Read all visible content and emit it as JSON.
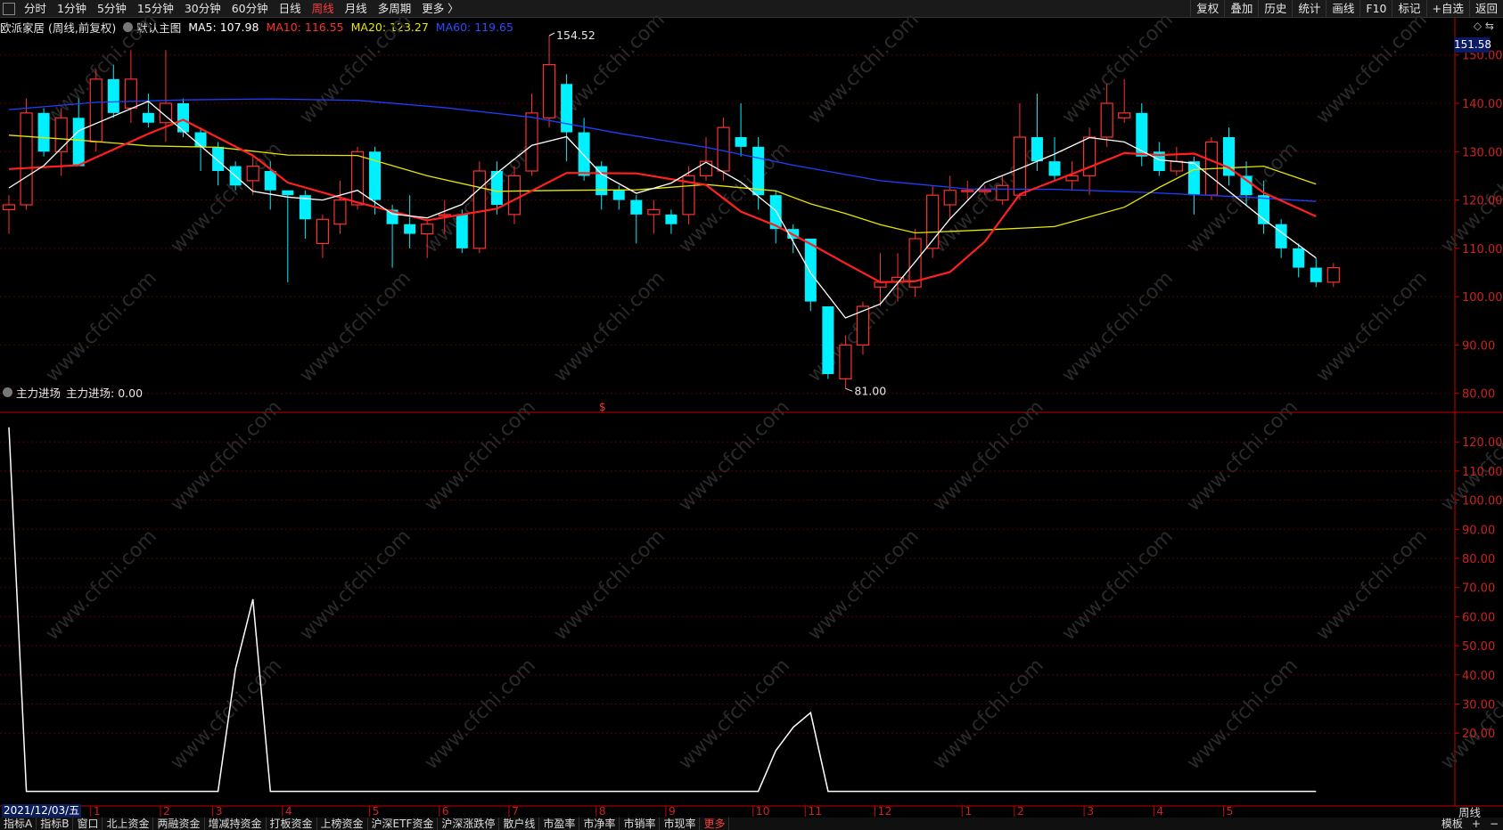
{
  "topbar": {
    "tabs": [
      "分时",
      "1分钟",
      "5分钟",
      "15分钟",
      "30分钟",
      "60分钟",
      "日线",
      "周线",
      "月线",
      "多周期",
      "更多 〉"
    ],
    "active_tab": "周线",
    "right_tools": [
      "复权",
      "叠加",
      "历史",
      "统计",
      "画线",
      "F10",
      "标记",
      "+自选",
      "返回"
    ]
  },
  "info": {
    "stock": "欧派家居 (周线,前复权)",
    "main_chart": "默认主图",
    "ma5": "MA5: 107.98",
    "ma10": "MA10: 116.55",
    "ma20": "MA20: 123.27",
    "ma60": "MA60: 119.65"
  },
  "colors": {
    "up": "#ff3030",
    "down": "#00f0ff",
    "ma5": "#ffffff",
    "ma10": "#ff2020",
    "ma20": "#e6e600",
    "ma60": "#1f3fff",
    "axis": "#cc0000"
  },
  "price_box": "151.58",
  "tiny_icons": "◇ ⇆",
  "annotations": {
    "high": "154.52",
    "low": "81.00",
    "marker": "$"
  },
  "panel2": {
    "title": "主力进场",
    "value": "主力进场: 0.00"
  },
  "date_label": "2021/12/03/五",
  "period_label": "周线",
  "bottom_tabs": [
    "指标A",
    "指标B",
    "窗口",
    "北上资金",
    "两融资金",
    "增减持资金",
    "打板资金",
    "上榜资金",
    "沪深ETF资金",
    "沪深涨跌停",
    "散户线",
    "市盈率",
    "市净率",
    "市销率",
    "市现率",
    "更多"
  ],
  "bottom_right": [
    "模板",
    "+",
    "−"
  ],
  "watermark": "www.cfchi.com",
  "chart_data": [
    {
      "type": "candlestick",
      "title": "欧派家居 (周线,前复权)",
      "ylim": [
        77,
        154
      ],
      "y_ticks": [
        80,
        90,
        100,
        110,
        120,
        130,
        140,
        150
      ],
      "y_tick_labels": [
        "80.00",
        "90.00",
        "100.00",
        "110.00",
        "120.00",
        "130.00",
        "140.00",
        "150.00"
      ],
      "x_month_labels": [
        [
          "1",
          5
        ],
        [
          "2",
          9
        ],
        [
          "3",
          12
        ],
        [
          "4",
          16
        ],
        [
          "5",
          21
        ],
        [
          "6",
          25
        ],
        [
          "7",
          29
        ],
        [
          "8",
          34
        ],
        [
          "9",
          38
        ],
        [
          "10",
          43
        ],
        [
          "11",
          46
        ],
        [
          "12",
          50
        ],
        [
          "1",
          55
        ],
        [
          "2",
          58
        ],
        [
          "3",
          62
        ],
        [
          "4",
          66
        ],
        [
          "5",
          70
        ]
      ],
      "candles": [
        [
          118,
          119,
          113,
          121
        ],
        [
          119,
          138,
          118,
          141
        ],
        [
          138,
          130,
          129,
          139
        ],
        [
          130,
          137,
          125,
          139
        ],
        [
          137,
          127,
          128,
          141
        ],
        [
          132,
          145,
          130,
          147
        ],
        [
          145,
          138,
          137,
          148
        ],
        [
          139,
          145,
          136,
          151
        ],
        [
          138,
          136,
          135,
          142
        ],
        [
          136,
          140,
          132,
          151
        ],
        [
          140,
          134,
          133,
          141
        ],
        [
          134,
          131,
          126,
          135
        ],
        [
          131,
          126,
          123,
          132
        ],
        [
          127,
          123,
          122,
          128
        ],
        [
          124,
          127,
          121,
          129
        ],
        [
          126,
          122,
          118,
          128
        ],
        [
          122,
          121,
          103,
          122
        ],
        [
          121,
          116,
          112,
          122
        ],
        [
          111,
          116,
          108,
          117
        ],
        [
          115,
          120,
          113,
          124
        ],
        [
          119,
          130,
          118,
          131
        ],
        [
          130,
          120,
          117,
          131
        ],
        [
          118,
          115,
          106,
          119
        ],
        [
          115,
          113,
          110,
          121
        ],
        [
          113,
          115,
          108,
          116
        ],
        [
          117,
          117,
          113,
          120
        ],
        [
          117,
          110,
          109,
          118
        ],
        [
          110,
          126,
          109,
          128
        ],
        [
          126,
          119,
          117,
          128
        ],
        [
          117,
          125,
          115,
          127
        ],
        [
          126,
          138,
          125,
          142
        ],
        [
          137,
          148,
          135,
          154
        ],
        [
          144,
          134,
          128,
          146
        ],
        [
          134,
          125,
          124,
          137
        ],
        [
          127,
          121,
          118,
          128
        ],
        [
          122,
          120,
          118,
          123
        ],
        [
          120,
          117,
          111,
          121
        ],
        [
          117,
          118,
          113,
          120
        ],
        [
          117,
          115,
          113,
          118
        ],
        [
          117,
          125,
          115,
          127
        ],
        [
          125,
          128,
          124,
          133
        ],
        [
          126,
          135,
          124,
          137
        ],
        [
          133,
          131,
          129,
          140
        ],
        [
          131,
          121,
          118,
          133
        ],
        [
          121,
          114,
          111,
          122
        ],
        [
          114,
          112,
          109,
          115
        ],
        [
          112,
          99,
          97,
          112
        ],
        [
          98,
          84,
          83,
          98
        ],
        [
          83,
          90,
          81,
          92
        ],
        [
          90,
          98,
          88,
          99
        ],
        [
          102,
          103,
          98,
          109
        ],
        [
          103,
          104,
          99,
          109
        ],
        [
          102,
          112,
          100,
          114
        ],
        [
          110,
          121,
          108,
          123
        ],
        [
          119,
          122,
          116,
          125
        ],
        [
          122,
          122,
          120,
          124
        ],
        [
          122,
          122,
          121,
          123
        ],
        [
          120,
          123,
          119,
          125
        ],
        [
          121,
          133,
          120,
          140
        ],
        [
          133,
          128,
          126,
          142
        ],
        [
          128,
          125,
          124,
          133
        ],
        [
          124,
          125,
          122,
          128
        ],
        [
          125,
          133,
          121,
          135
        ],
        [
          133,
          140,
          131,
          144
        ],
        [
          137,
          138,
          136,
          145
        ],
        [
          138,
          129,
          127,
          140
        ],
        [
          130,
          126,
          125,
          132
        ],
        [
          126,
          128,
          125,
          131
        ],
        [
          128,
          121,
          117,
          129
        ],
        [
          121,
          132,
          120,
          133
        ],
        [
          133,
          125,
          123,
          135
        ],
        [
          125,
          121,
          119,
          128
        ],
        [
          121,
          115,
          113,
          124
        ],
        [
          115,
          110,
          108,
          116
        ],
        [
          110,
          106,
          104,
          111
        ],
        [
          106,
          103,
          102,
          108
        ],
        [
          103,
          106,
          102,
          107
        ]
      ],
      "ma60": [
        [
          0,
          138.7
        ],
        [
          5,
          140.2
        ],
        [
          10,
          140.7
        ],
        [
          15,
          140.9
        ],
        [
          20,
          140.6
        ],
        [
          25,
          139.1
        ],
        [
          30,
          137.1
        ],
        [
          35,
          133.8
        ],
        [
          40,
          130.9
        ],
        [
          45,
          127.2
        ],
        [
          50,
          124.0
        ],
        [
          55,
          122.3
        ],
        [
          60,
          122.2
        ],
        [
          65,
          121.6
        ],
        [
          71,
          120.6
        ],
        [
          75,
          119.7
        ]
      ],
      "ma20": [
        [
          0,
          133.4
        ],
        [
          4,
          132.4
        ],
        [
          8,
          131.2
        ],
        [
          12,
          130.9
        ],
        [
          16,
          129.3
        ],
        [
          20,
          129.2
        ],
        [
          24,
          125.0
        ],
        [
          28,
          121.8
        ],
        [
          32,
          122.0
        ],
        [
          36,
          122.1
        ],
        [
          40,
          123.2
        ],
        [
          44,
          121.9
        ],
        [
          46,
          119.2
        ],
        [
          48,
          117.2
        ],
        [
          50,
          114.9
        ],
        [
          52,
          113.2
        ],
        [
          56,
          113.8
        ],
        [
          60,
          114.5
        ],
        [
          64,
          118.5
        ],
        [
          66,
          122.6
        ],
        [
          68,
          126.3
        ],
        [
          72,
          127.0
        ],
        [
          75,
          123.3
        ]
      ],
      "ma10": [
        [
          0,
          126.4
        ],
        [
          4,
          127.2
        ],
        [
          8,
          133.7
        ],
        [
          10,
          136.6
        ],
        [
          14,
          129.2
        ],
        [
          16,
          123.6
        ],
        [
          20,
          119.5
        ],
        [
          24,
          115.8
        ],
        [
          28,
          118.2
        ],
        [
          32,
          125.6
        ],
        [
          36,
          125.5
        ],
        [
          40,
          123.1
        ],
        [
          42,
          117.6
        ],
        [
          44,
          114.7
        ],
        [
          46,
          110.9
        ],
        [
          48,
          106.9
        ],
        [
          50,
          103.0
        ],
        [
          52,
          103.2
        ],
        [
          54,
          105.1
        ],
        [
          56,
          111.4
        ],
        [
          58,
          121.2
        ],
        [
          62,
          126.8
        ],
        [
          64,
          129.7
        ],
        [
          66,
          129.3
        ],
        [
          68,
          129.6
        ],
        [
          70,
          126.7
        ],
        [
          72,
          121.5
        ],
        [
          75,
          116.6
        ]
      ],
      "ma5": [
        [
          0,
          122.5
        ],
        [
          2,
          127.1
        ],
        [
          4,
          134.3
        ],
        [
          8,
          140.4
        ],
        [
          10,
          134.3
        ],
        [
          12,
          128.1
        ],
        [
          14,
          121.8
        ],
        [
          16,
          120.6
        ],
        [
          18,
          120.0
        ],
        [
          20,
          122.0
        ],
        [
          22,
          117.1
        ],
        [
          24,
          116.3
        ],
        [
          26,
          119.1
        ],
        [
          28,
          125.6
        ],
        [
          30,
          131.3
        ],
        [
          32,
          133.1
        ],
        [
          34,
          125.4
        ],
        [
          36,
          121.4
        ],
        [
          38,
          123.5
        ],
        [
          40,
          127.8
        ],
        [
          42,
          123.7
        ],
        [
          44,
          117.8
        ],
        [
          46,
          104.9
        ],
        [
          48,
          95.6
        ],
        [
          50,
          98.5
        ],
        [
          52,
          107.2
        ],
        [
          54,
          116.1
        ],
        [
          56,
          123.6
        ],
        [
          58,
          126.5
        ],
        [
          60,
          129.5
        ],
        [
          62,
          132.9
        ],
        [
          64,
          132.0
        ],
        [
          66,
          128.3
        ],
        [
          68,
          127.6
        ],
        [
          70,
          121.8
        ],
        [
          72,
          116.0
        ],
        [
          75,
          108.0
        ]
      ]
    },
    {
      "type": "line",
      "title": "主力进场",
      "ylim": [
        -5,
        128
      ],
      "y_ticks": [
        20,
        30,
        40,
        50,
        60,
        70,
        80,
        90,
        100,
        110,
        120
      ],
      "y_tick_labels": [
        "20.00",
        "30.00",
        "40.00",
        "50.00",
        "60.00",
        "70.00",
        "80.00",
        "90.00",
        "100.00",
        "110.00",
        "120.00"
      ],
      "points": [
        [
          0,
          125
        ],
        [
          1,
          0
        ],
        [
          12,
          0
        ],
        [
          13,
          42
        ],
        [
          14,
          66
        ],
        [
          15,
          0
        ],
        [
          43,
          0
        ],
        [
          44,
          14
        ],
        [
          45,
          22
        ],
        [
          46,
          27
        ],
        [
          47,
          0
        ],
        [
          75,
          0
        ]
      ]
    }
  ]
}
